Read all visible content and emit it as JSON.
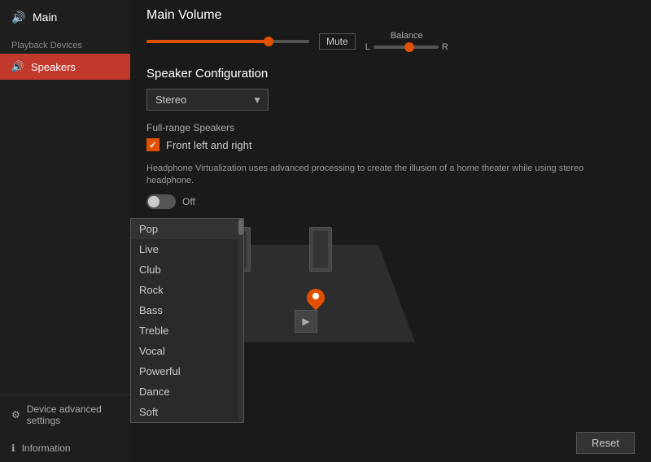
{
  "sidebar": {
    "header": {
      "icon": "🔊",
      "title": "Main"
    },
    "sections": [
      {
        "label": "Playback Devices",
        "items": [
          {
            "id": "speakers",
            "label": "Speakers",
            "icon": "🔊",
            "active": true
          }
        ]
      }
    ],
    "bottom": [
      {
        "id": "device-advanced",
        "label": "Device advanced settings",
        "icon": "⚙"
      },
      {
        "id": "information",
        "label": "Information",
        "icon": "ℹ"
      }
    ]
  },
  "main": {
    "volume_title": "Main Volume",
    "mute_label": "Mute",
    "balance_label": "Balance",
    "balance_left": "L",
    "balance_right": "R",
    "speaker_config_title": "Speaker Configuration",
    "stereo_option": "Stereo",
    "full_range_title": "Full-range Speakers",
    "front_left_right_label": "Front left and right",
    "virt_desc": "Headphone Virtualization uses advanced processing to create the illusion of a home theater while using stereo headphone.",
    "toggle_state": "Off",
    "reset_label": "Reset",
    "dropdown_items": [
      {
        "id": "pop",
        "label": "Pop",
        "selected": true
      },
      {
        "id": "live",
        "label": "Live"
      },
      {
        "id": "club",
        "label": "Club"
      },
      {
        "id": "rock",
        "label": "Rock"
      },
      {
        "id": "bass",
        "label": "Bass"
      },
      {
        "id": "treble",
        "label": "Treble"
      },
      {
        "id": "vocal",
        "label": "Vocal"
      },
      {
        "id": "powerful",
        "label": "Powerful"
      },
      {
        "id": "dance",
        "label": "Dance"
      },
      {
        "id": "soft",
        "label": "Soft"
      }
    ]
  }
}
